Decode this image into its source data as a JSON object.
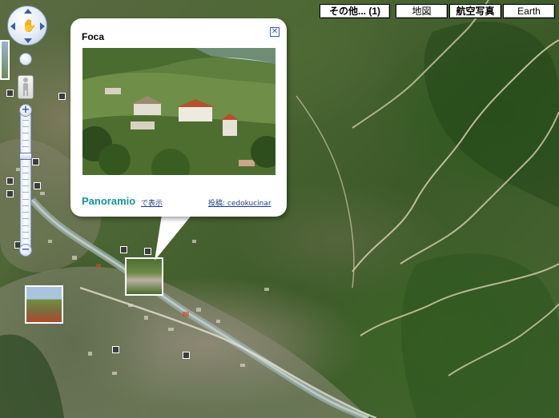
{
  "map": {
    "type_buttons": [
      {
        "label": "その他... (1)",
        "active": true
      },
      {
        "label": "地図",
        "active": false
      },
      {
        "label": "航空写真",
        "active": true
      },
      {
        "label": "Earth",
        "active": false
      }
    ],
    "controls": {
      "pan_icon": "hand-pan-icon",
      "zoom_in_label": "+",
      "zoom_out_label": "−",
      "zoom_level_fraction": 0.28,
      "pegman_icon": "pegman-icon"
    }
  },
  "info_window": {
    "title": "Foca",
    "close_icon": "close-icon",
    "brand": "Panoramio",
    "view_link": "で表示",
    "author_link": "投稿: cedokucinar"
  },
  "colors": {
    "brand_teal": "#1a8f9d",
    "link_blue": "#1c3b8a",
    "control_blue": "#3a5fa6"
  }
}
